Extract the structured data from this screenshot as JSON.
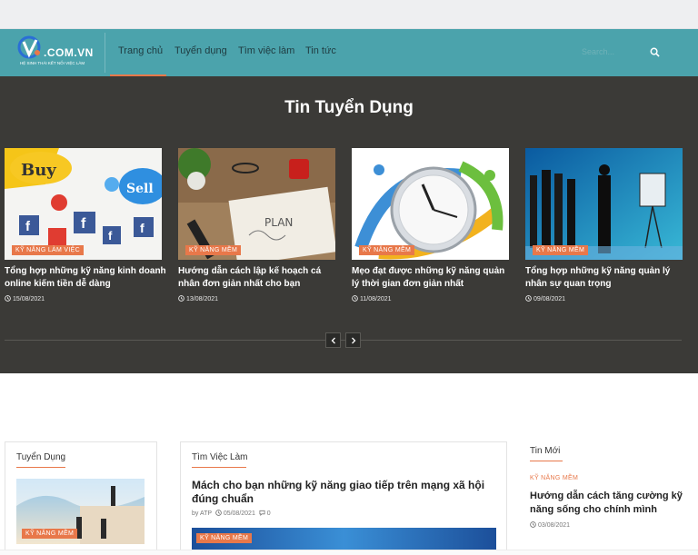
{
  "header": {
    "logo_text": ".COM.VN",
    "logo_tagline": "HỆ SINH THÁI KẾT NỐI VIỆC LÀM",
    "nav": [
      {
        "label": "Trang chủ"
      },
      {
        "label": "Tuyển dụng"
      },
      {
        "label": "Tìm việc làm"
      },
      {
        "label": "Tin tức"
      }
    ],
    "search_placeholder": "Search..."
  },
  "hero": {
    "title": "Tin Tuyển Dụng",
    "cards": [
      {
        "tag": "Kỹ năng làm việc",
        "title": "Tổng hợp những kỹ năng kinh doanh online kiếm tiền dễ dàng",
        "date": "15/08/2021"
      },
      {
        "tag": "Kỹ năng mềm",
        "title": "Hướng dẫn cách lập kế hoạch cá nhân đơn giản nhất cho bạn",
        "date": "13/08/2021"
      },
      {
        "tag": "Kỹ năng mềm",
        "title": "Mẹo đạt được những kỹ năng quản lý thời gian đơn giản nhất",
        "date": "11/08/2021"
      },
      {
        "tag": "Kỹ năng mềm",
        "title": "Tổng hợp những kỹ năng quản lý nhân sự quan trọng",
        "date": "09/08/2021"
      }
    ]
  },
  "sections": {
    "left": {
      "title": "Tuyển Dụng",
      "tag": "Kỹ năng mềm"
    },
    "middle": {
      "title": "Tìm Việc Làm",
      "post_title": "Mách cho bạn những kỹ năng giao tiếp trên mạng xã hội đúng chuẩn",
      "author": "by ATP",
      "date": "05/08/2021",
      "comments": "0",
      "tag": "Kỹ năng mềm"
    },
    "right": {
      "title": "Tin Mới",
      "tag": "Kỹ năng mềm",
      "post_title": "Hướng dẫn cách tăng cường kỹ năng sống cho chính mình",
      "date": "03/08/2021"
    }
  },
  "colors": {
    "teal": "#4ba3ac",
    "dark": "#3b3a37",
    "accent": "#e8784a"
  }
}
